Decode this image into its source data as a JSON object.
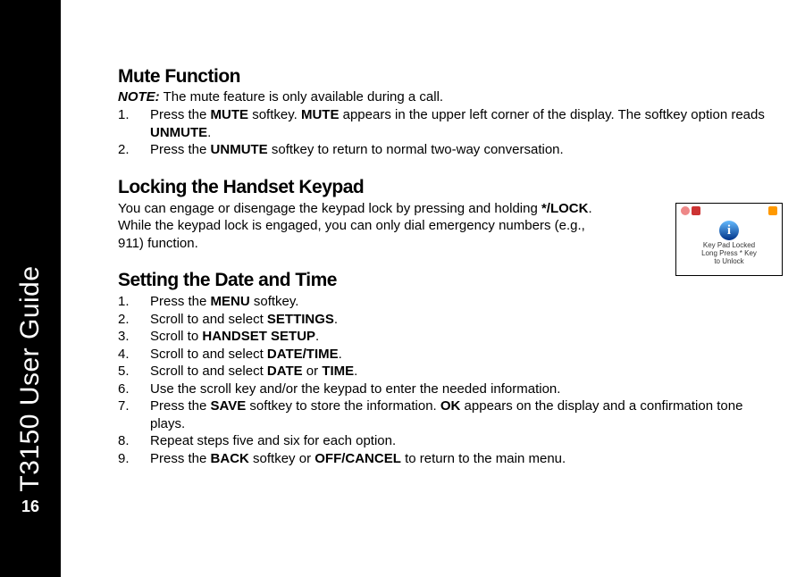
{
  "sidebar": {
    "guide_title": "T3150 User Guide",
    "page_number": "16"
  },
  "sections": {
    "mute": {
      "heading": "Mute Function",
      "note_label": "NOTE:",
      "note_text": " The mute feature is only available during a call.",
      "step1_a": "Press the ",
      "step1_b": "MUTE",
      "step1_c": " softkey. ",
      "step1_d": "MUTE",
      "step1_e": " appears in the upper left corner of the display. The softkey option reads ",
      "step1_f": "UNMUTE",
      "step1_g": ".",
      "step2_a": "Press the ",
      "step2_b": "UNMUTE",
      "step2_c": " softkey to return to normal two-way conversation."
    },
    "lock": {
      "heading": "Locking the Handset Keypad",
      "p1_a": "You can engage or disengage the keypad lock by pressing and holding ",
      "p1_b": "*/LOCK",
      "p1_c": ". While the keypad lock is engaged, you can only dial emergency numbers (e.g., 911) function.",
      "box": {
        "line1": "Key Pad Locked",
        "line2": "Long Press * Key",
        "line3": "to Unlock"
      }
    },
    "datetime": {
      "heading": "Setting the Date and Time",
      "s1_a": "Press the ",
      "s1_b": "MENU",
      "s1_c": " softkey.",
      "s2_a": "Scroll to and select ",
      "s2_b": "SETTINGS",
      "s2_c": ".",
      "s3_a": "Scroll to ",
      "s3_b": "HANDSET SETUP",
      "s3_c": ".",
      "s4_a": "Scroll to and select ",
      "s4_b": "DATE/TIME",
      "s4_c": ".",
      "s5_a": "Scroll to and select ",
      "s5_b": "DATE",
      "s5_c": " or ",
      "s5_d": "TIME",
      "s5_e": ".",
      "s6": "Use the scroll key and/or the keypad to enter the needed information.",
      "s7_a": "Press the ",
      "s7_b": "SAVE",
      "s7_c": " softkey to store the information. ",
      "s7_d": "OK",
      "s7_e": " appears on the display and a confirmation tone plays.",
      "s8": "Repeat steps five and six for each option.",
      "s9_a": "Press the ",
      "s9_b": "BACK",
      "s9_c": " softkey or ",
      "s9_d": "OFF/CANCEL",
      "s9_e": " to return to the main menu."
    }
  }
}
